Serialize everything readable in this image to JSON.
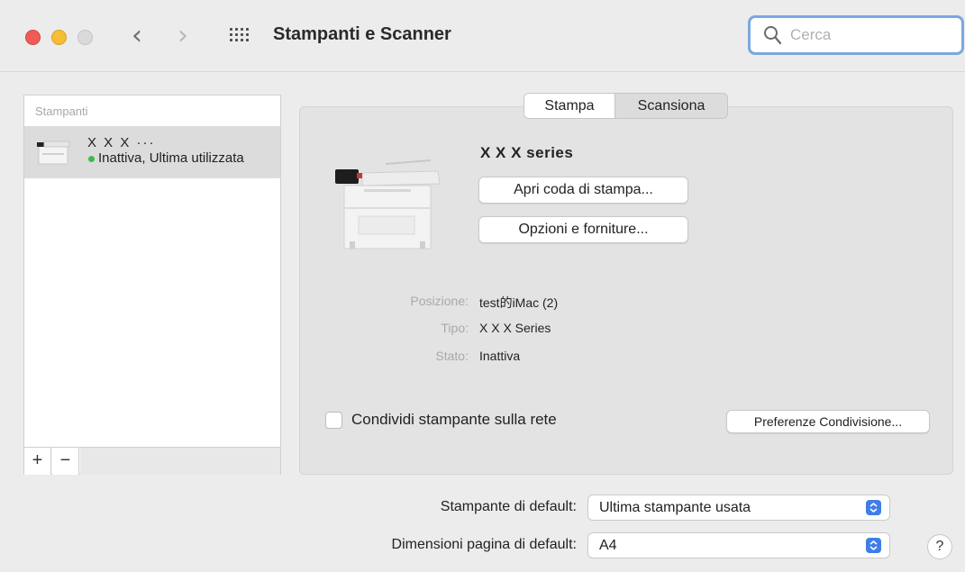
{
  "window": {
    "title": "Stampanti e Scanner"
  },
  "search": {
    "placeholder": "Cerca"
  },
  "sidebar": {
    "header": "Stampanti",
    "items": [
      {
        "name": "X X X ···",
        "status": "Inattiva, Ultima utilizzata",
        "status_color": "#3dbb4a"
      }
    ],
    "add_label": "+",
    "remove_label": "−"
  },
  "tabs": [
    {
      "label": "Stampa",
      "active": true
    },
    {
      "label": "Scansiona",
      "active": false
    }
  ],
  "printer": {
    "name": "X X X  series",
    "open_queue_label": "Apri coda di stampa...",
    "options_label": "Opzioni e forniture...",
    "info": [
      {
        "label": "Posizione:",
        "value": "test的iMac (2)"
      },
      {
        "label": "Tipo:",
        "value": "X X X   Series"
      },
      {
        "label": "Stato:",
        "value": "Inattiva"
      }
    ],
    "share_label": "Condividi stampante sulla rete",
    "share_checked": false,
    "share_prefs_label": "Preferenze Condivisione..."
  },
  "defaults": {
    "printer_label": "Stampante di default:",
    "printer_value": "Ultima stampante usata",
    "page_size_label": "Dimensioni pagina di default:",
    "page_size_value": "A4"
  },
  "help_label": "?",
  "colors": {
    "accent": "#3f7ee8",
    "search_focus": "#7ba7e0"
  }
}
